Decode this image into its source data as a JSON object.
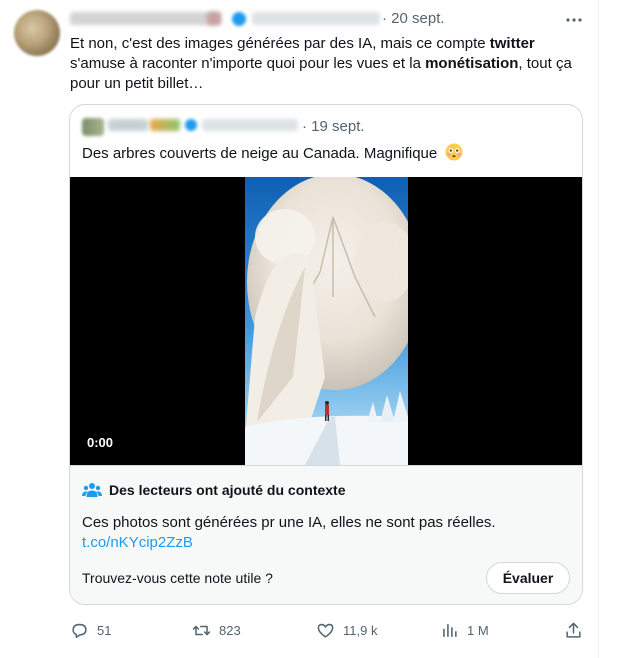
{
  "tweet": {
    "date": "· 20 sept.",
    "text_parts": [
      "Et non, c'est des images générées par des IA, mais ce compte ",
      "twitter",
      " s'amuse à raconter n'importe quoi pour les vues et la ",
      "monétisation",
      ", tout ça pour un petit billet…"
    ]
  },
  "quoted": {
    "date": "· 19 sept.",
    "text": "Des arbres couverts de neige au Canada. Magnifique",
    "emoji": "flushed-face-emoji",
    "video_time": "0:00"
  },
  "community_note": {
    "title": "Des lecteurs ont ajouté du contexte",
    "body": "Ces photos sont générées pr une IA, elles ne sont pas réelles.",
    "link": "t.co/nKYcip2ZzB",
    "question": "Trouvez-vous cette note utile ?",
    "button": "Évaluer"
  },
  "actions": {
    "replies": "51",
    "retweets": "823",
    "likes": "11,9 k",
    "views": "1 M"
  },
  "colors": {
    "accent": "#1d9bf0",
    "secondary_text": "#536471",
    "border": "#cfd9de"
  }
}
